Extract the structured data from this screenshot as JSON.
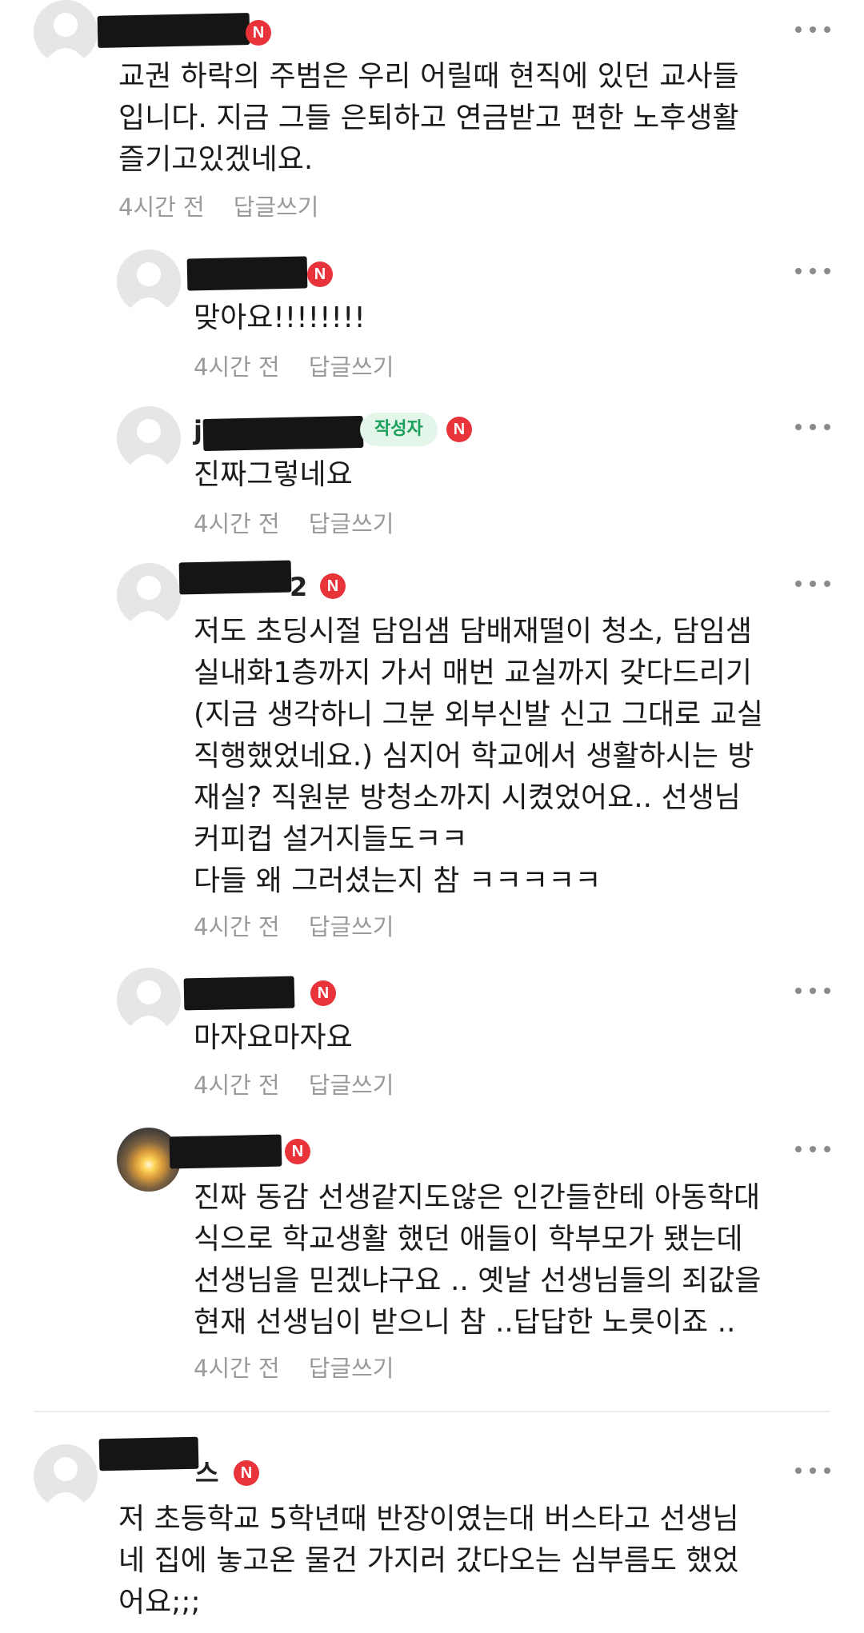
{
  "badge_label": "N",
  "reply_label": "답글쓰기",
  "author_tag": "작성자",
  "comments": [
    {
      "name_visible": "",
      "text": "교권 하락의 주범은 우리 어릴때 현직에 있던 교사들\n입니다. 지금 그들 은퇴하고 연금받고 편한 노후생활\n즐기고있겠네요.",
      "time": "4시간 전"
    },
    {
      "name_visible": "",
      "text": "맞아요!!!!!!!!",
      "time": "4시간 전"
    },
    {
      "name_visible": "j",
      "text": "진짜그렇네요",
      "time": "4시간 전"
    },
    {
      "name_visible": "2",
      "text": "저도 초딩시절 담임샘 담배재떨이 청소, 담임샘\n실내화1층까지 가서 매번 교실까지 갖다드리기\n(지금 생각하니 그분 외부신발 신고 그대로 교실\n직행했었네요.) 심지어 학교에서 생활하시는 방\n재실? 직원분 방청소까지 시켰었어요.. 선생님\n커피컵 설거지들도ㅋㅋ\n다들 왜 그러셨는지 참 ㅋㅋㅋㅋㅋ",
      "time": "4시간 전"
    },
    {
      "name_visible": "",
      "text": "마자요마자요",
      "time": "4시간 전"
    },
    {
      "name_visible": "",
      "text": "진짜 동감 선생같지도않은 인간들한테 아동학대\n식으로 학교생활 했던 애들이 학부모가 됐는데\n선생님을 믿겠냐구요 .. 옛날 선생님들의 죄값을\n현재 선생님이 받으니 참 ..답답한 노릇이죠 ..",
      "time": "4시간 전"
    },
    {
      "name_visible": "스",
      "text": "저 초등학교 5학년때 반장이였는대 버스타고 선생님\n네 집에 놓고온 물건 가지러 갔다오는 심부름도 했었\n어요;;;",
      "time": ""
    }
  ]
}
